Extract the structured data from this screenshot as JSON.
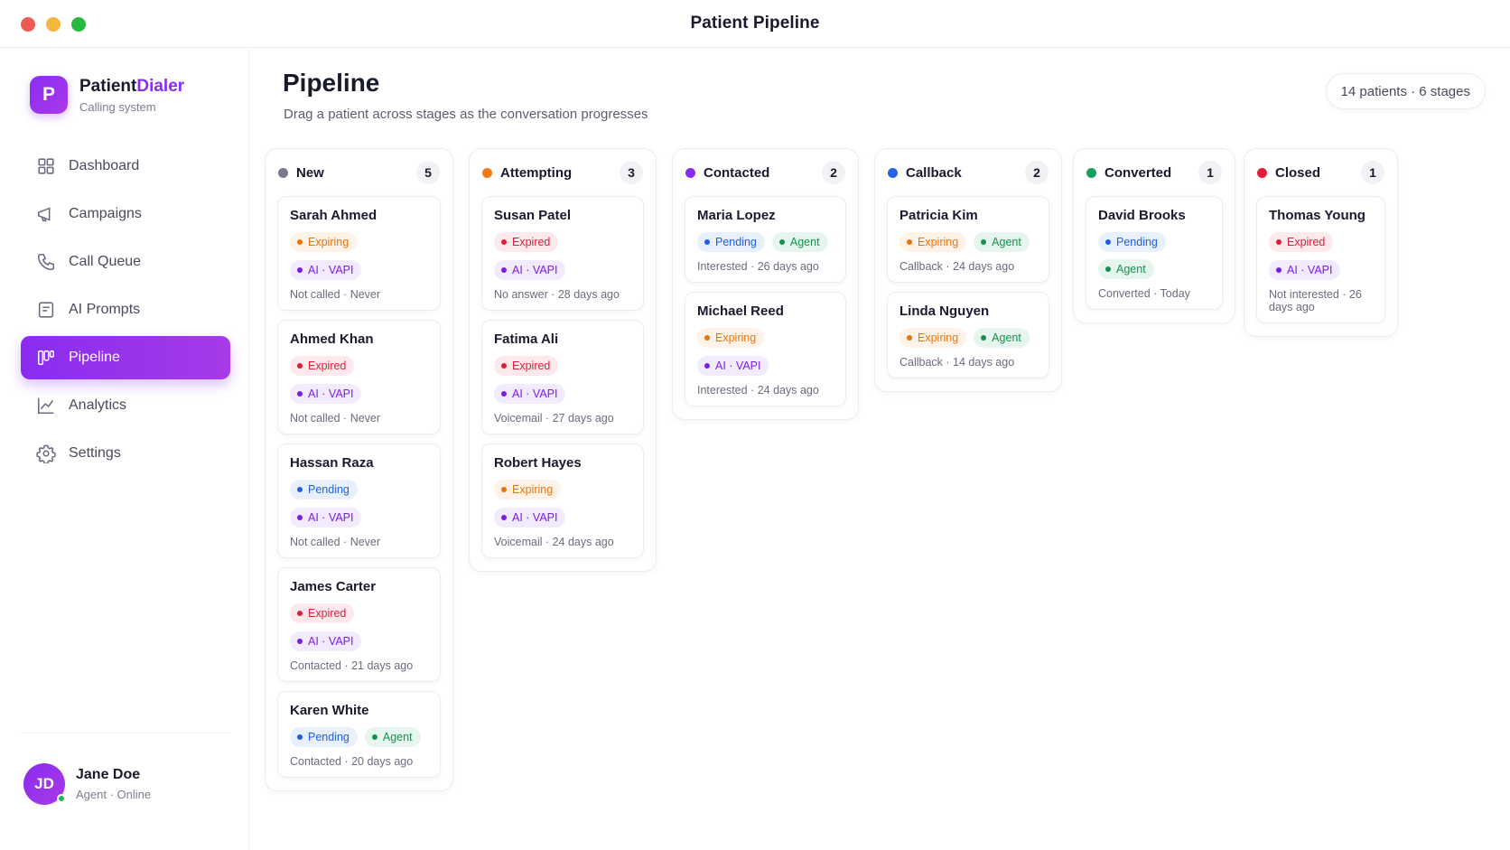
{
  "window": {
    "title": "Patient Pipeline"
  },
  "brand": {
    "logo_letter": "P",
    "name_part1": "Patient",
    "name_part2": "Dialer",
    "subtitle": "Calling system"
  },
  "nav": [
    {
      "label": "Dashboard",
      "icon": "dashboard-icon",
      "active": false
    },
    {
      "label": "Campaigns",
      "icon": "megaphone-icon",
      "active": false
    },
    {
      "label": "Call Queue",
      "icon": "phone-icon",
      "active": false
    },
    {
      "label": "AI Prompts",
      "icon": "document-icon",
      "active": false
    },
    {
      "label": "Pipeline",
      "icon": "pipeline-icon",
      "active": true
    },
    {
      "label": "Analytics",
      "icon": "chart-icon",
      "active": false
    },
    {
      "label": "Settings",
      "icon": "gear-icon",
      "active": false
    }
  ],
  "user": {
    "initials": "JD",
    "name": "Jane Doe",
    "status": "Agent · Online"
  },
  "page": {
    "title": "Pipeline",
    "subtitle": "Drag a patient across stages as the conversation progresses",
    "summary": "14 patients · 6 stages"
  },
  "colors": {
    "accent": "#8a2cf0",
    "new": "#7a7a8c",
    "attempting": "#f07a1a",
    "contacted": "#8a2cf0",
    "callback": "#2563eb",
    "converted": "#16a060",
    "closed": "#e01e3c"
  },
  "columns": [
    {
      "name": "New",
      "count": "5",
      "color_key": "new",
      "cards": [
        {
          "name": "Sarah Ahmed",
          "tags": [
            [
              "expiring",
              "Expiring"
            ]
          ],
          "tags2": [
            [
              "ai",
              "AI · VAPI"
            ]
          ],
          "meta": "Not called · Never"
        },
        {
          "name": "Ahmed Khan",
          "tags": [
            [
              "expired",
              "Expired"
            ]
          ],
          "tags2": [
            [
              "ai",
              "AI · VAPI"
            ]
          ],
          "meta": "Not called · Never"
        },
        {
          "name": "Hassan Raza",
          "tags": [
            [
              "pending",
              "Pending"
            ]
          ],
          "tags2": [
            [
              "ai",
              "AI · VAPI"
            ]
          ],
          "meta": "Not called · Never"
        },
        {
          "name": "James Carter",
          "tags": [
            [
              "expired",
              "Expired"
            ]
          ],
          "tags2": [
            [
              "ai",
              "AI · VAPI"
            ]
          ],
          "meta": "Contacted · 21 days ago"
        },
        {
          "name": "Karen White",
          "tags": [
            [
              "pending",
              "Pending"
            ],
            [
              "agent",
              "Agent"
            ]
          ],
          "tags2": [],
          "meta": "Contacted · 20 days ago"
        }
      ]
    },
    {
      "name": "Attempting",
      "count": "3",
      "color_key": "attempting",
      "cards": [
        {
          "name": "Susan Patel",
          "tags": [
            [
              "expired",
              "Expired"
            ]
          ],
          "tags2": [
            [
              "ai",
              "AI · VAPI"
            ]
          ],
          "meta": "No answer · 28 days ago"
        },
        {
          "name": "Fatima Ali",
          "tags": [
            [
              "expired",
              "Expired"
            ]
          ],
          "tags2": [
            [
              "ai",
              "AI · VAPI"
            ]
          ],
          "meta": "Voicemail · 27 days ago"
        },
        {
          "name": "Robert Hayes",
          "tags": [
            [
              "expiring",
              "Expiring"
            ]
          ],
          "tags2": [
            [
              "ai",
              "AI · VAPI"
            ]
          ],
          "meta": "Voicemail · 24 days ago"
        }
      ]
    },
    {
      "name": "Contacted",
      "count": "2",
      "color_key": "contacted",
      "cards": [
        {
          "name": "Maria Lopez",
          "tags": [
            [
              "pending",
              "Pending"
            ],
            [
              "agent",
              "Agent"
            ]
          ],
          "tags2": [],
          "meta": "Interested · 26 days ago"
        },
        {
          "name": "Michael Reed",
          "tags": [
            [
              "expiring",
              "Expiring"
            ]
          ],
          "tags2": [
            [
              "ai",
              "AI · VAPI"
            ]
          ],
          "meta": "Interested · 24 days ago"
        }
      ]
    },
    {
      "name": "Callback",
      "count": "2",
      "color_key": "callback",
      "cards": [
        {
          "name": "Patricia Kim",
          "tags": [
            [
              "expiring",
              "Expiring"
            ],
            [
              "agent",
              "Agent"
            ]
          ],
          "tags2": [],
          "meta": "Callback · 24 days ago"
        },
        {
          "name": "Linda Nguyen",
          "tags": [
            [
              "expiring",
              "Expiring"
            ],
            [
              "agent",
              "Agent"
            ]
          ],
          "tags2": [],
          "meta": "Callback · 14 days ago"
        }
      ]
    },
    {
      "name": "Converted",
      "count": "1",
      "color_key": "converted",
      "cards": [
        {
          "name": "David Brooks",
          "tags": [
            [
              "pending",
              "Pending"
            ],
            [
              "agent",
              "Agent"
            ]
          ],
          "tags2": [],
          "meta": "Converted · Today"
        }
      ]
    },
    {
      "name": "Closed",
      "count": "1",
      "color_key": "closed",
      "cards": [
        {
          "name": "Thomas Young",
          "tags": [
            [
              "expired",
              "Expired"
            ]
          ],
          "tags2": [
            [
              "ai",
              "AI · VAPI"
            ]
          ],
          "meta": "Not interested · 26 days ago"
        }
      ]
    }
  ]
}
